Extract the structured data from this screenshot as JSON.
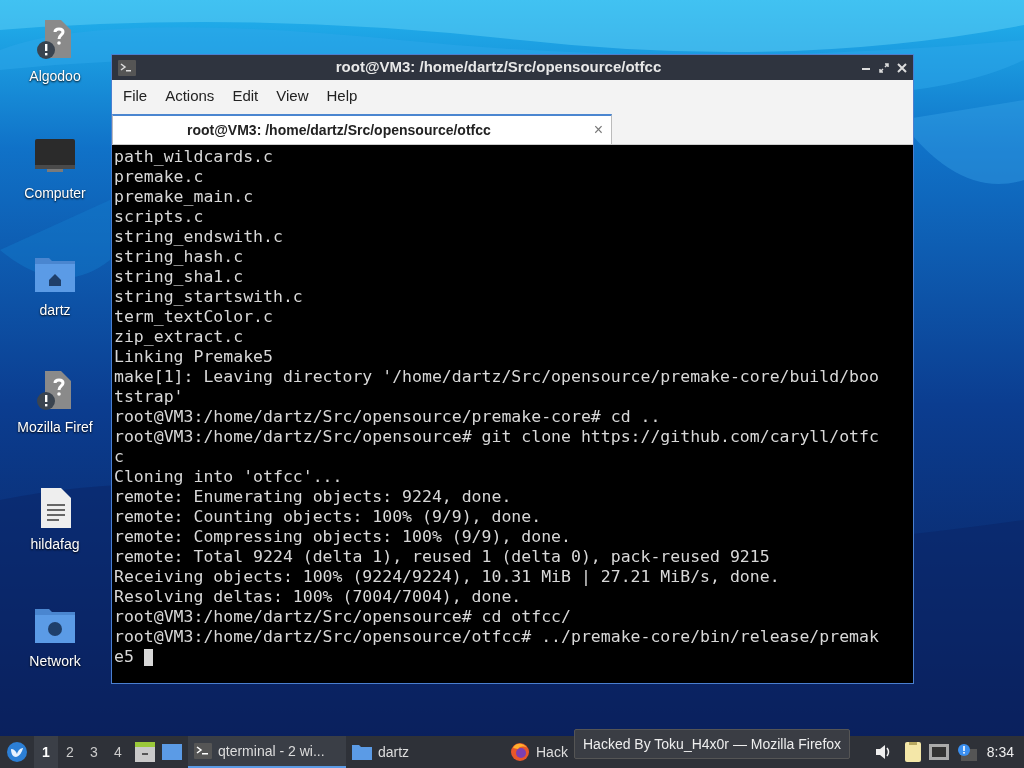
{
  "desktop_icons": [
    {
      "label": "Algodoo",
      "kind": "unknown"
    },
    {
      "label": "Computer",
      "kind": "computer"
    },
    {
      "label": "dartz",
      "kind": "home"
    },
    {
      "label": "Mozilla Firef",
      "kind": "unknown"
    },
    {
      "label": "hildafag",
      "kind": "document"
    },
    {
      "label": "Network",
      "kind": "network"
    }
  ],
  "window": {
    "title": "root@VM3: /home/dartz/Src/opensource/otfcc",
    "menu": [
      "File",
      "Actions",
      "Edit",
      "View",
      "Help"
    ],
    "tabs": [
      {
        "label": "root@VM3: /home/dartz/Src/opensource/otfcc",
        "close": "×",
        "selected": true
      }
    ],
    "terminal_lines": [
      "path_wildcards.c",
      "premake.c",
      "premake_main.c",
      "scripts.c",
      "string_endswith.c",
      "string_hash.c",
      "string_sha1.c",
      "string_startswith.c",
      "term_textColor.c",
      "zip_extract.c",
      "Linking Premake5",
      "make[1]: Leaving directory '/home/dartz/Src/opensource/premake-core/build/boo",
      "tstrap'",
      "root@VM3:/home/dartz/Src/opensource/premake-core# cd ..",
      "root@VM3:/home/dartz/Src/opensource# git clone https://github.com/caryll/otfc",
      "c",
      "Cloning into 'otfcc'...",
      "remote: Enumerating objects: 9224, done.",
      "remote: Counting objects: 100% (9/9), done.",
      "remote: Compressing objects: 100% (9/9), done.",
      "remote: Total 9224 (delta 1), reused 1 (delta 0), pack-reused 9215",
      "Receiving objects: 100% (9224/9224), 10.31 MiB | 27.21 MiB/s, done.",
      "Resolving deltas: 100% (7004/7004), done.",
      "root@VM3:/home/dartz/Src/opensource# cd otfcc/",
      "root@VM3:/home/dartz/Src/opensource/otfcc# ../premake-core/bin/release/premak",
      "e5 "
    ]
  },
  "taskbar": {
    "workspaces": [
      {
        "label": "1",
        "selected": true
      },
      {
        "label": "2",
        "selected": false
      },
      {
        "label": "3",
        "selected": false
      },
      {
        "label": "4",
        "selected": false
      }
    ],
    "tasks": [
      {
        "label": "qterminal - 2 wi...",
        "kind": "terminal",
        "selected": true
      },
      {
        "label": "dartz",
        "kind": "folder",
        "selected": false
      },
      {
        "label": "Hack",
        "kind": "firefox",
        "selected": false
      }
    ],
    "tooltip": "Hacked By Toku_H4x0r — Mozilla Firefox",
    "clock": "8:34"
  }
}
